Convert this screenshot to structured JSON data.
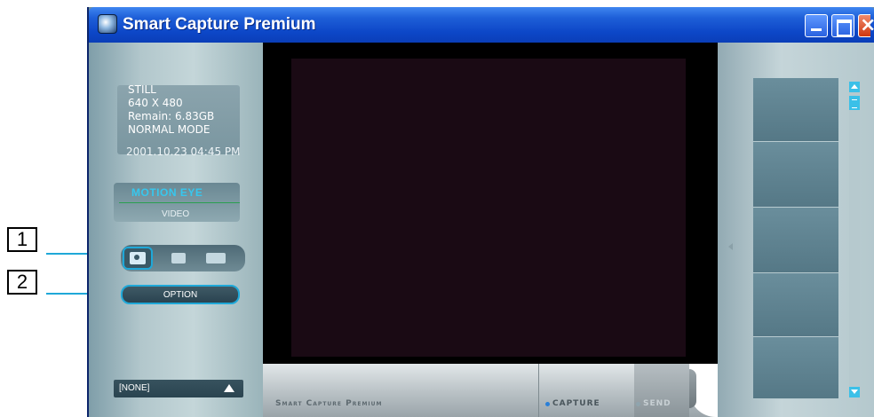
{
  "callouts": [
    {
      "label": "1"
    },
    {
      "label": "2"
    }
  ],
  "window": {
    "title": "Smart Capture Premium",
    "icon": "smart-capture-app-icon",
    "controls": [
      "minimize-icon",
      "maximize-icon",
      "close-icon"
    ]
  },
  "left_panel": {
    "info": {
      "mode": "STILL",
      "resolution": "640 X 480",
      "remain": "Remain: 6.83GB",
      "quality": "NORMAL MODE",
      "timestamp": "2001.10.23 04:45 PM"
    },
    "motion_eye": "MOTION EYE",
    "video": "VIDEO",
    "mode_buttons": [
      {
        "icon": "camera-icon",
        "selected": true
      },
      {
        "icon": "video-camera-icon",
        "selected": false
      },
      {
        "icon": "video-mail-icon",
        "selected": false
      }
    ],
    "option_label": "OPTION",
    "effect_select": "[NONE]"
  },
  "bottom_bar": {
    "brand": "Smart Capture Premium",
    "capture_label": "CAPTURE",
    "send_label": "SEND"
  },
  "colors": {
    "title_bar": "#0d47c8",
    "highlight": "#1fa8d8",
    "preview_bg": "#1a0a14",
    "scroll_accent": "#3bc0e8"
  }
}
